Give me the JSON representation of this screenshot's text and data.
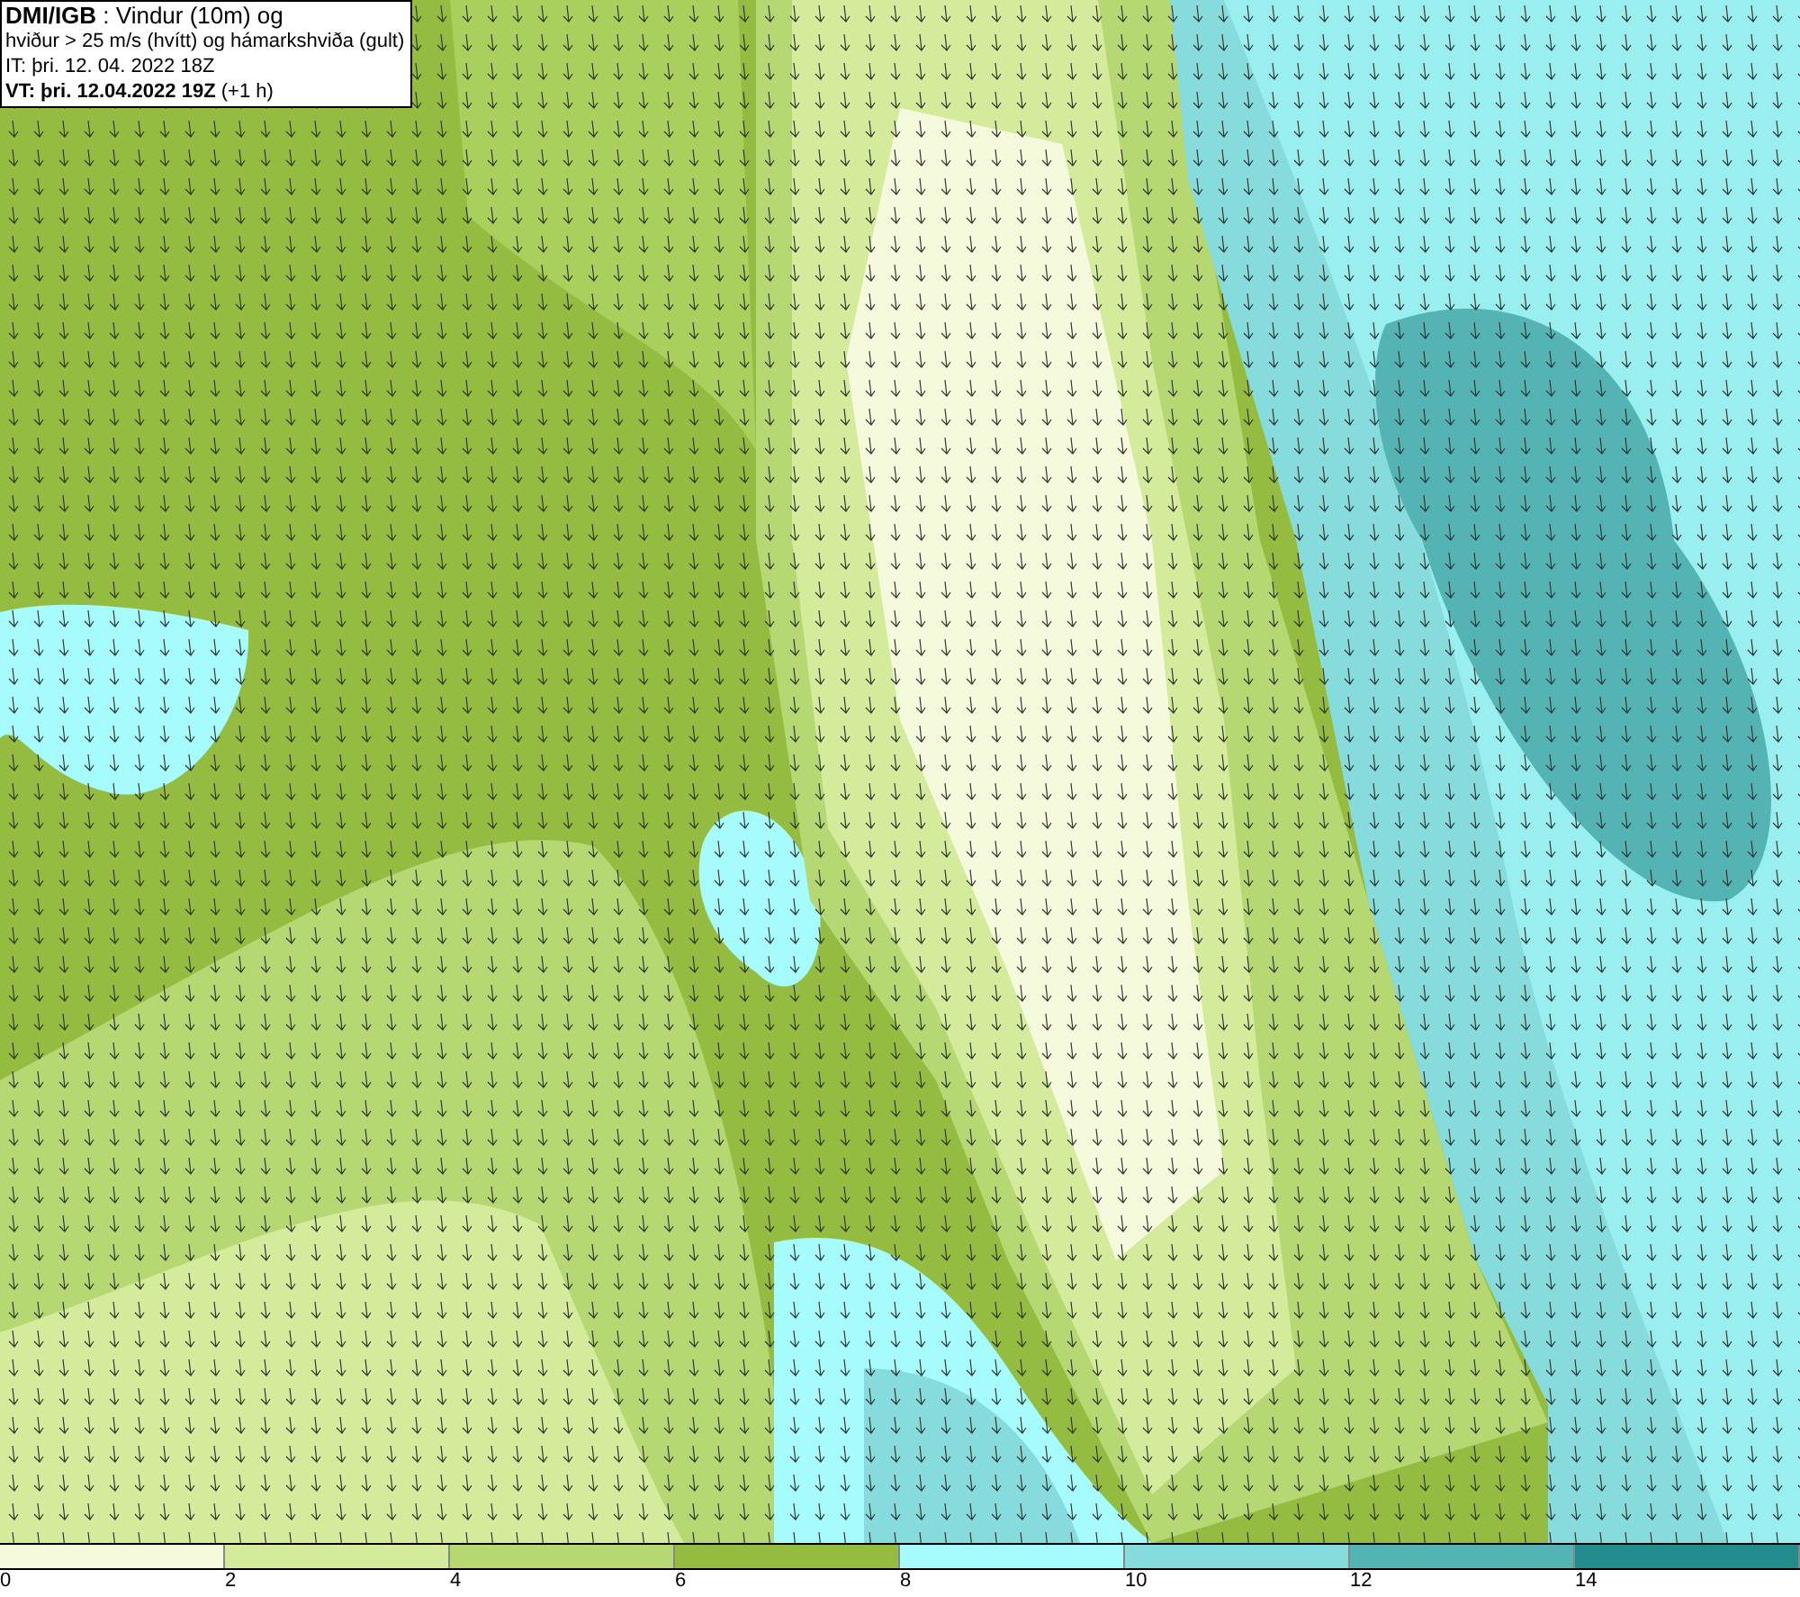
{
  "header": {
    "lines": [
      "**DMI/IGB** : Vindur (10m) og",
      "hviður > 25 m/s (hvítt) og hámarkshviða (gult)",
      "IT: þri. 12. 04. 2022 18Z",
      "**VT: þri. 12.04.2022 19Z** (+1 h)"
    ]
  },
  "legend": {
    "bins": [
      {
        "color": "#f5fadc",
        "label": "0"
      },
      {
        "color": "#d4eb9c",
        "label": "2"
      },
      {
        "color": "#b5d873",
        "label": "4"
      },
      {
        "color": "#94bc40",
        "label": "6"
      },
      {
        "color": "#a6fcfc",
        "label": "8"
      },
      {
        "color": "#86dcdc",
        "label": "10"
      },
      {
        "color": "#54b4b4",
        "label": "12"
      },
      {
        "color": "#238c8c",
        "label": "14"
      }
    ]
  }
}
